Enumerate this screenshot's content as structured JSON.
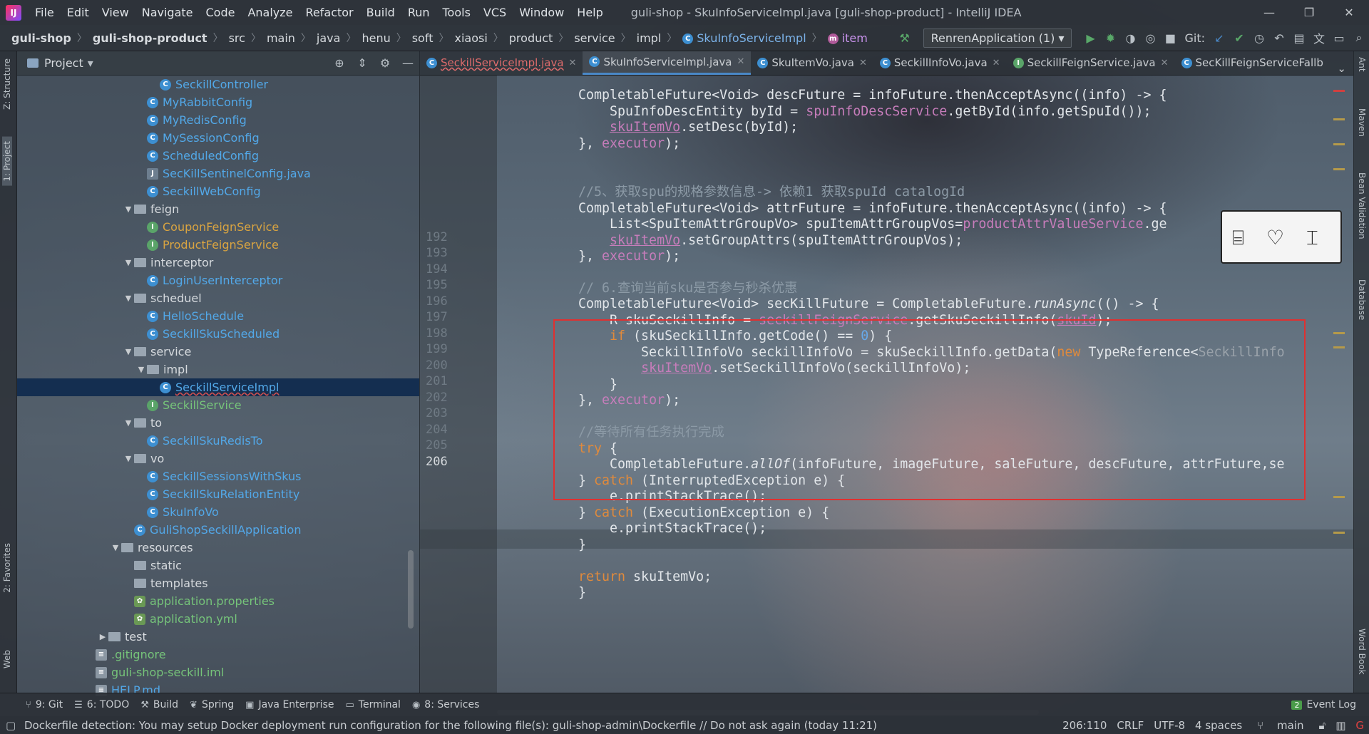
{
  "window": {
    "title": "guli-shop - SkuInfoServiceImpl.java [guli-shop-product] - IntelliJ IDEA",
    "logo_text": "IJ",
    "controls": [
      "—",
      "❐",
      "✕"
    ]
  },
  "menu": [
    "File",
    "Edit",
    "View",
    "Navigate",
    "Code",
    "Analyze",
    "Refactor",
    "Build",
    "Run",
    "Tools",
    "VCS",
    "Window",
    "Help"
  ],
  "breadcrumb": [
    "guli-shop",
    "guli-shop-product",
    "src",
    "main",
    "java",
    "henu",
    "soft",
    "xiaosi",
    "product",
    "service",
    "impl",
    "SkuInfoServiceImpl",
    "item"
  ],
  "toolbar": {
    "run_config": "RenrenApplication (1)",
    "git_label": "Git:"
  },
  "project_panel": {
    "title": "Project",
    "tree": [
      {
        "indent": 3,
        "arrow": "",
        "icon": "c",
        "label": "SeckillController",
        "color": "blue"
      },
      {
        "indent": 2,
        "arrow": "",
        "icon": "c",
        "label": "MyRabbitConfig",
        "color": "blue"
      },
      {
        "indent": 2,
        "arrow": "",
        "icon": "c",
        "label": "MyRedisConfig",
        "color": "blue"
      },
      {
        "indent": 2,
        "arrow": "",
        "icon": "c",
        "label": "MySessionConfig",
        "color": "blue"
      },
      {
        "indent": 2,
        "arrow": "",
        "icon": "c",
        "label": "ScheduledConfig",
        "color": "blue"
      },
      {
        "indent": 2,
        "arrow": "",
        "icon": "j",
        "label": "SecKillSentinelConfig.java",
        "color": "blue"
      },
      {
        "indent": 2,
        "arrow": "",
        "icon": "c",
        "label": "SeckillWebConfig",
        "color": "blue"
      },
      {
        "indent": 1,
        "arrow": "▼",
        "icon": "folder",
        "label": "feign",
        "color": "normal"
      },
      {
        "indent": 2,
        "arrow": "",
        "icon": "i",
        "label": "CouponFeignService",
        "color": "orange"
      },
      {
        "indent": 2,
        "arrow": "",
        "icon": "i",
        "label": "ProductFeignService",
        "color": "orange"
      },
      {
        "indent": 1,
        "arrow": "▼",
        "icon": "folder",
        "label": "interceptor",
        "color": "normal"
      },
      {
        "indent": 2,
        "arrow": "",
        "icon": "c",
        "label": "LoginUserInterceptor",
        "color": "blue"
      },
      {
        "indent": 1,
        "arrow": "▼",
        "icon": "folder",
        "label": "scheduel",
        "color": "normal"
      },
      {
        "indent": 2,
        "arrow": "",
        "icon": "c",
        "label": "HelloSchedule",
        "color": "blue"
      },
      {
        "indent": 2,
        "arrow": "",
        "icon": "c",
        "label": "SeckillSkuScheduled",
        "color": "blue"
      },
      {
        "indent": 1,
        "arrow": "▼",
        "icon": "folder",
        "label": "service",
        "color": "normal"
      },
      {
        "indent": 2,
        "arrow": "▼",
        "icon": "folder",
        "label": "impl",
        "color": "normal"
      },
      {
        "indent": 3,
        "arrow": "",
        "icon": "c",
        "label": "SeckillServiceImpl",
        "color": "blue",
        "selected": true
      },
      {
        "indent": 2,
        "arrow": "",
        "icon": "i",
        "label": "SeckillService",
        "color": "green"
      },
      {
        "indent": 1,
        "arrow": "▼",
        "icon": "folder",
        "label": "to",
        "color": "normal"
      },
      {
        "indent": 2,
        "arrow": "",
        "icon": "c",
        "label": "SeckillSkuRedisTo",
        "color": "blue"
      },
      {
        "indent": 1,
        "arrow": "▼",
        "icon": "folder",
        "label": "vo",
        "color": "normal"
      },
      {
        "indent": 2,
        "arrow": "",
        "icon": "c",
        "label": "SeckillSessionsWithSkus",
        "color": "blue"
      },
      {
        "indent": 2,
        "arrow": "",
        "icon": "c",
        "label": "SeckillSkuRelationEntity",
        "color": "blue"
      },
      {
        "indent": 2,
        "arrow": "",
        "icon": "c",
        "label": "SkuInfoVo",
        "color": "blue"
      },
      {
        "indent": 1,
        "arrow": "",
        "icon": "g",
        "label": "GuliShopSeckillApplication",
        "color": "blue"
      },
      {
        "indent": 0,
        "arrow": "▼",
        "icon": "folder",
        "label": "resources",
        "color": "normal"
      },
      {
        "indent": 1,
        "arrow": "",
        "icon": "folder",
        "label": "static",
        "color": "normal"
      },
      {
        "indent": 1,
        "arrow": "",
        "icon": "folder",
        "label": "templates",
        "color": "normal"
      },
      {
        "indent": 1,
        "arrow": "",
        "icon": "p",
        "label": "application.properties",
        "color": "green"
      },
      {
        "indent": 1,
        "arrow": "",
        "icon": "p",
        "label": "application.yml",
        "color": "green"
      },
      {
        "indent": -1,
        "arrow": "▶",
        "icon": "folder",
        "label": "test",
        "color": "normal"
      },
      {
        "indent": -2,
        "arrow": "",
        "icon": "f",
        "label": ".gitignore",
        "color": "green"
      },
      {
        "indent": -2,
        "arrow": "",
        "icon": "f",
        "label": "guli-shop-seckill.iml",
        "color": "green"
      },
      {
        "indent": -2,
        "arrow": "",
        "icon": "f",
        "label": "HELP.md",
        "color": "blue"
      }
    ]
  },
  "tabs": [
    {
      "label": "SeckillServiceImpl.java",
      "error": true,
      "active": false
    },
    {
      "label": "SkuInfoServiceImpl.java",
      "error": false,
      "active": true
    },
    {
      "label": "SkuItemVo.java",
      "error": false,
      "active": false
    },
    {
      "label": "SeckillInfoVo.java",
      "error": false,
      "active": false
    },
    {
      "label": "SeckillFeignService.java",
      "error": false,
      "active": false
    },
    {
      "label": "SecKillFeignServiceFallb",
      "error": false,
      "active": false
    }
  ],
  "gutter_lines": [
    "",
    "",
    "",
    "",
    "",
    "",
    "",
    "",
    "",
    "192",
    "193",
    "194",
    "195",
    "196",
    "197",
    "198",
    "199",
    "200",
    "201",
    "202",
    "203",
    "204",
    "205",
    "206",
    "",
    "",
    "",
    "",
    "",
    "",
    ""
  ],
  "current_line_index": 23,
  "left_vtabs": [
    "Z: Structure",
    "1: Project",
    "2: Favorites",
    "Web"
  ],
  "right_vtabs": [
    "Ant",
    "Maven",
    "Bean Validation",
    "Database",
    "Word Book"
  ],
  "bottom_tools": [
    "9: Git",
    "6: TODO",
    "Build",
    "Spring",
    "Java Enterprise",
    "Terminal",
    "8: Services"
  ],
  "event_log": {
    "label": "Event Log",
    "count": "2"
  },
  "status": {
    "message": "Dockerfile detection: You may setup Docker deployment run configuration for the following file(s): guli-shop-admin\\Dockerfile // Do not ask again (today 11:21)",
    "position": "206:110",
    "line_sep": "CRLF",
    "encoding": "UTF-8",
    "indent": "4 spaces",
    "branch": "main"
  },
  "colors": {
    "highlight_box": "#e03030",
    "selection": "#0d294e",
    "keyword": "#e08a3c",
    "field": "#c77dbb"
  }
}
